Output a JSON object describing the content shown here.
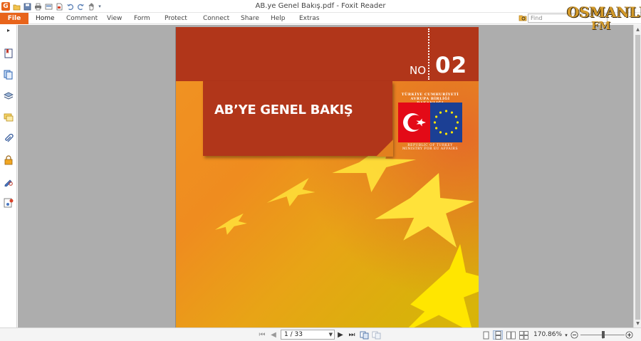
{
  "window": {
    "title": "AB.ye Genel Bakış.pdf - Foxit Reader"
  },
  "quick_access": [
    "app-logo",
    "open-icon",
    "save-icon",
    "print-icon",
    "scan-icon",
    "new-doc-icon",
    "undo-icon",
    "redo-icon",
    "hand-tool-icon",
    "customize-icon"
  ],
  "ribbon": {
    "tabs": [
      "File",
      "Home",
      "Comment",
      "View",
      "Form",
      "Protect",
      "Connect",
      "Share",
      "Help",
      "Extras"
    ],
    "active_tab": "Home",
    "find_placeholder": "Find"
  },
  "watermark": {
    "line1": "OSMANLI",
    "line2": "FM"
  },
  "sidebar": {
    "items": [
      "bookmarks-icon",
      "pages-icon",
      "layers-icon",
      "comments-icon",
      "attachments-icon",
      "security-icon",
      "signature-icon",
      "content-icon"
    ]
  },
  "document": {
    "number_label": "NO",
    "number": "02",
    "title": "AB’YE GENEL BAKIŞ",
    "ministry_tr_line1": "TÜRKİYE CUMHURİYETİ",
    "ministry_tr_line2": "AVRUPA BİRLİĞİ BAKANLIĞI",
    "ministry_en_line1": "REPUBLIC OF TURKEY",
    "ministry_en_line2": "MINISTRY FOR EU AFFAIRS"
  },
  "statusbar": {
    "page_display": "1 / 33",
    "zoom": "170.86%"
  },
  "colors": {
    "accent": "#e8641b",
    "cover_red": "#b1361a",
    "turkey_red": "#e30a17",
    "eu_blue": "#1b3f94",
    "star_yellow": "#ffe600"
  }
}
